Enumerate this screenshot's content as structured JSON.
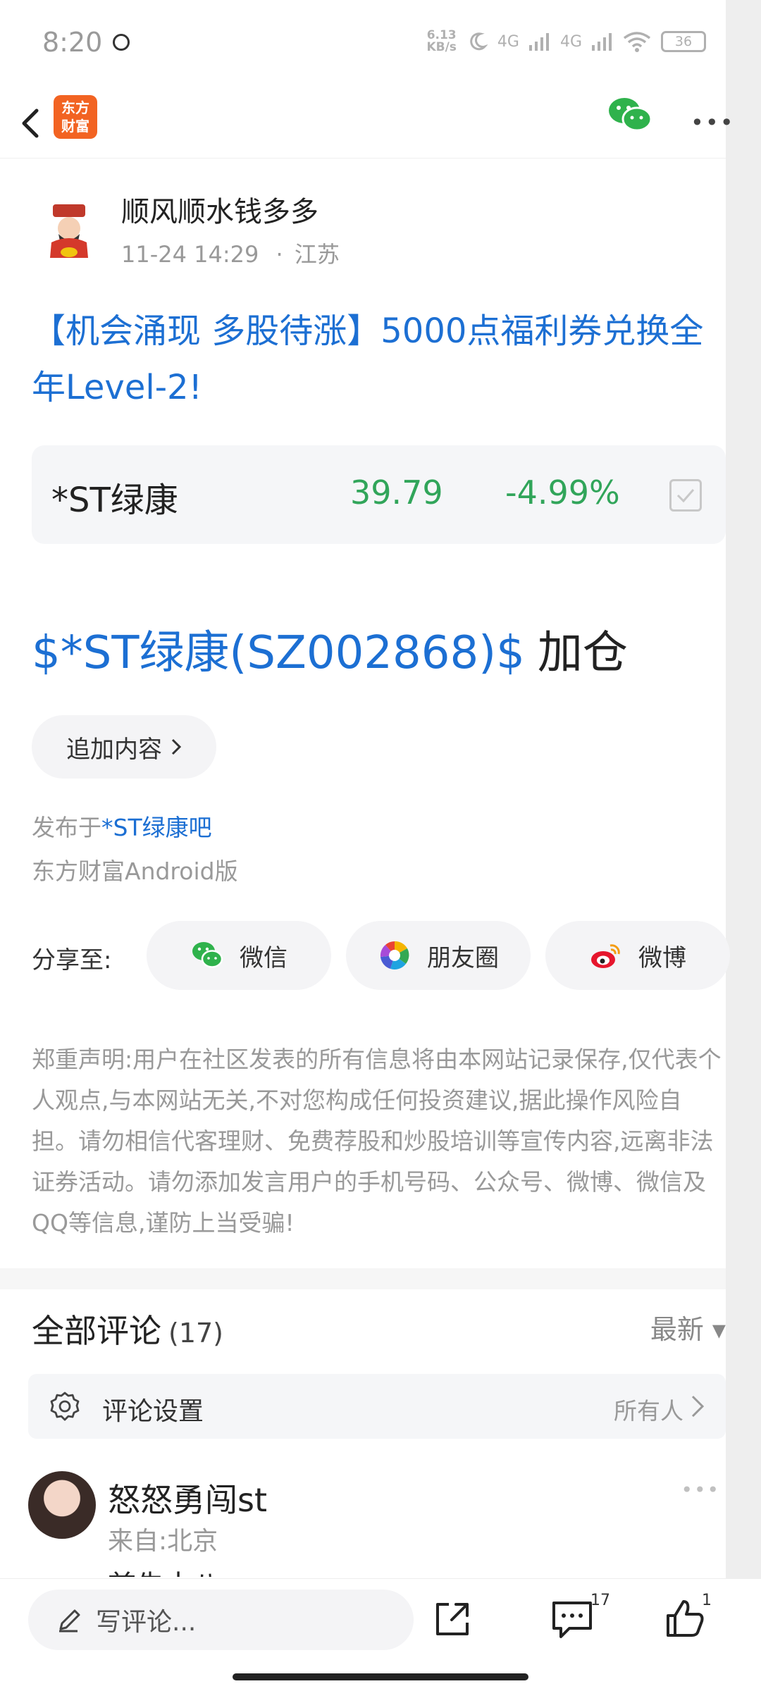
{
  "status_bar": {
    "time": "8:20",
    "net_speed_value": "6.13",
    "net_speed_unit": "KB/s",
    "network_1": "4G",
    "network_2": "4G",
    "battery": "36"
  },
  "nav": {
    "logo_line1": "东方",
    "logo_line2": "财富"
  },
  "post": {
    "author_name": "顺风顺水钱多多",
    "date": "11-24 14:29",
    "location_separator": "·",
    "location": "江苏",
    "title": "【机会涌现 多股待涨】5000点福利券兑换全年Level-2!",
    "stock": {
      "name": "*ST绿康",
      "price": "39.79",
      "change": "-4.99%",
      "color": "#31a55a"
    },
    "body_link": "$*ST绿康(SZ002868)$",
    "body_text": "加仓",
    "append_button": "追加内容",
    "published_prefix": "发布于",
    "published_bar": "*ST绿康吧",
    "client": "东方财富Android版"
  },
  "share": {
    "label": "分享至:",
    "wechat": "微信",
    "moments": "朋友圈",
    "weibo": "微博"
  },
  "disclaimer": "郑重声明:用户在社区发表的所有信息将由本网站记录保存,仅代表个人观点,与本网站无关,不对您构成任何投资建议,据此操作风险自担。请勿相信代客理财、免费荐股和炒股培训等宣传内容,远离非法证券活动。请勿添加发言用户的手机号码、公众号、微博、微信及QQ等信息,谨防上当受骗!",
  "comments": {
    "title": "全部评论",
    "count": "(17)",
    "sort": "最新 ▾",
    "settings_label": "评论设置",
    "audience": "所有人",
    "first": {
      "username": "怒怒勇闯st",
      "location": "来自:北京",
      "text_peek": "首先十八"
    }
  },
  "bottom_bar": {
    "input_placeholder": "写评论...",
    "comment_count": "17",
    "like_count": "1"
  },
  "colors": {
    "link_blue": "#1c6fd3",
    "down_green": "#31a55a",
    "brand_orange": "#f26322"
  }
}
